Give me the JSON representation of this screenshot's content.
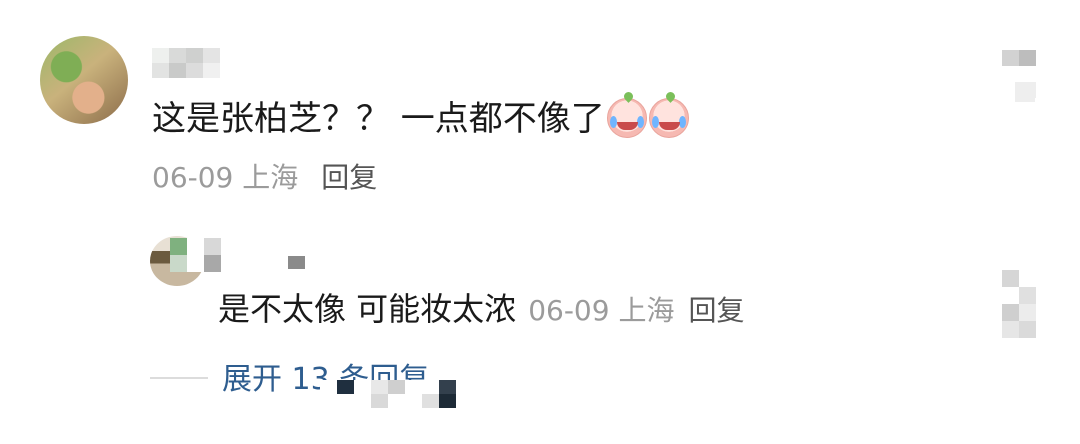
{
  "comment": {
    "text": "这是张柏芝？？ 一点都不像了",
    "emojis": [
      "crying-laughing-peach-icon",
      "crying-laughing-peach-icon"
    ],
    "date": "06-09",
    "location": "上海",
    "reply_label": "回复"
  },
  "reply": {
    "text": "是不太像 可能妆太浓",
    "date": "06-09",
    "location": "上海",
    "reply_label": "回复"
  },
  "expand_replies": {
    "label": "展开 13 条回复"
  },
  "colors": {
    "text": "#1a1a1a",
    "meta": "#9b9b9b",
    "link": "#2e5d8f"
  }
}
